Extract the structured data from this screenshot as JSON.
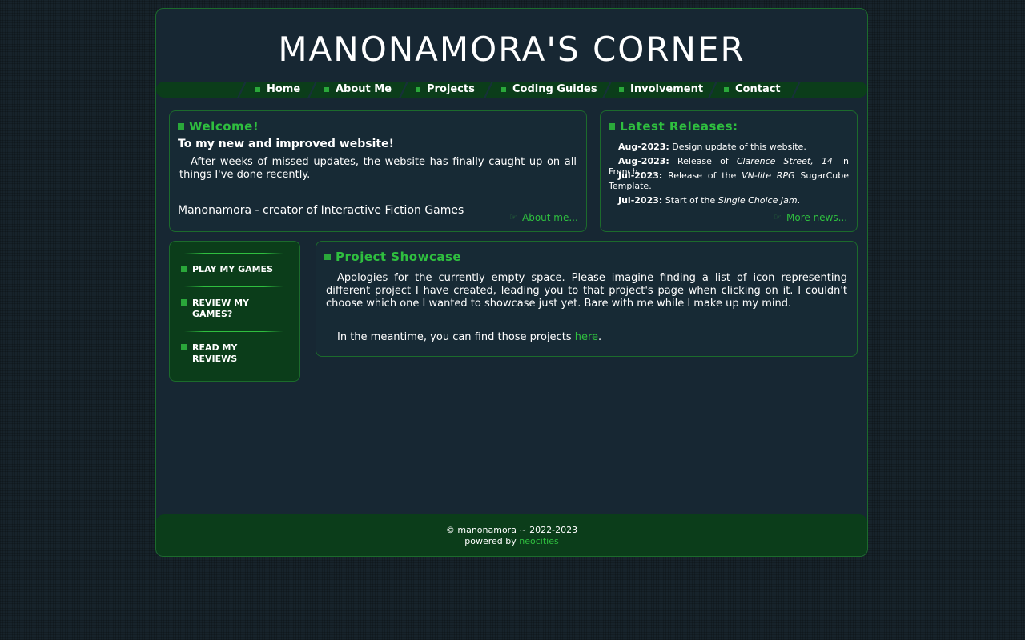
{
  "site": {
    "title": "MANONAMORA'S CORNER"
  },
  "nav": [
    {
      "label": "Home"
    },
    {
      "label": "About Me"
    },
    {
      "label": "Projects"
    },
    {
      "label": "Coding Guides"
    },
    {
      "label": "Involvement"
    },
    {
      "label": "Contact"
    }
  ],
  "welcome": {
    "title": "Welcome!",
    "subtitle": "To my new and improved website!",
    "text": "After weeks of missed updates, the website has finally caught up on all things I've done recently.",
    "tagline": "Manonamora - creator of Interactive Fiction Games",
    "link": "About me..."
  },
  "releases": {
    "title": "Latest Releases:",
    "items": [
      {
        "date": "Aug-2023:",
        "pre": " Design update of this website.",
        "em": "",
        "post": ""
      },
      {
        "date": "Aug-2023:",
        "pre": " Release of ",
        "em": "Clarence Street, 14",
        "post": " in French."
      },
      {
        "date": "Jul-2023:",
        "pre": " Release of the ",
        "em": "VN-lite RPG",
        "post": " SugarCube Template."
      },
      {
        "date": "Jul-2023:",
        "pre": " Start of the ",
        "em": "Single Choice Jam",
        "post": "."
      }
    ],
    "link": "More news..."
  },
  "sidebar": {
    "items": [
      {
        "label": "PLAY MY GAMES"
      },
      {
        "label": "REVIEW MY GAMES?"
      },
      {
        "label": "READ MY REVIEWS"
      }
    ]
  },
  "showcase": {
    "title": "Project Showcase",
    "text": "Apologies for the currently empty space. Please imagine finding a list of icon representing different project I have created, leading you to that project's page when clicking on it. I couldn't choose which one I wanted to showcase just yet. Bare with me while I make up my mind.",
    "text2_pre": "In the meantime, you can find those projects ",
    "text2_link": "here",
    "text2_post": "."
  },
  "footer": {
    "copyright": "© manonamora ~ 2022-2023",
    "powered_pre": "powered by ",
    "powered_link": "neocities"
  },
  "colors": {
    "accent": "#2fbf3f",
    "panel": "#0b3d1a",
    "background": "#17232b",
    "border": "#1c6b2c"
  }
}
